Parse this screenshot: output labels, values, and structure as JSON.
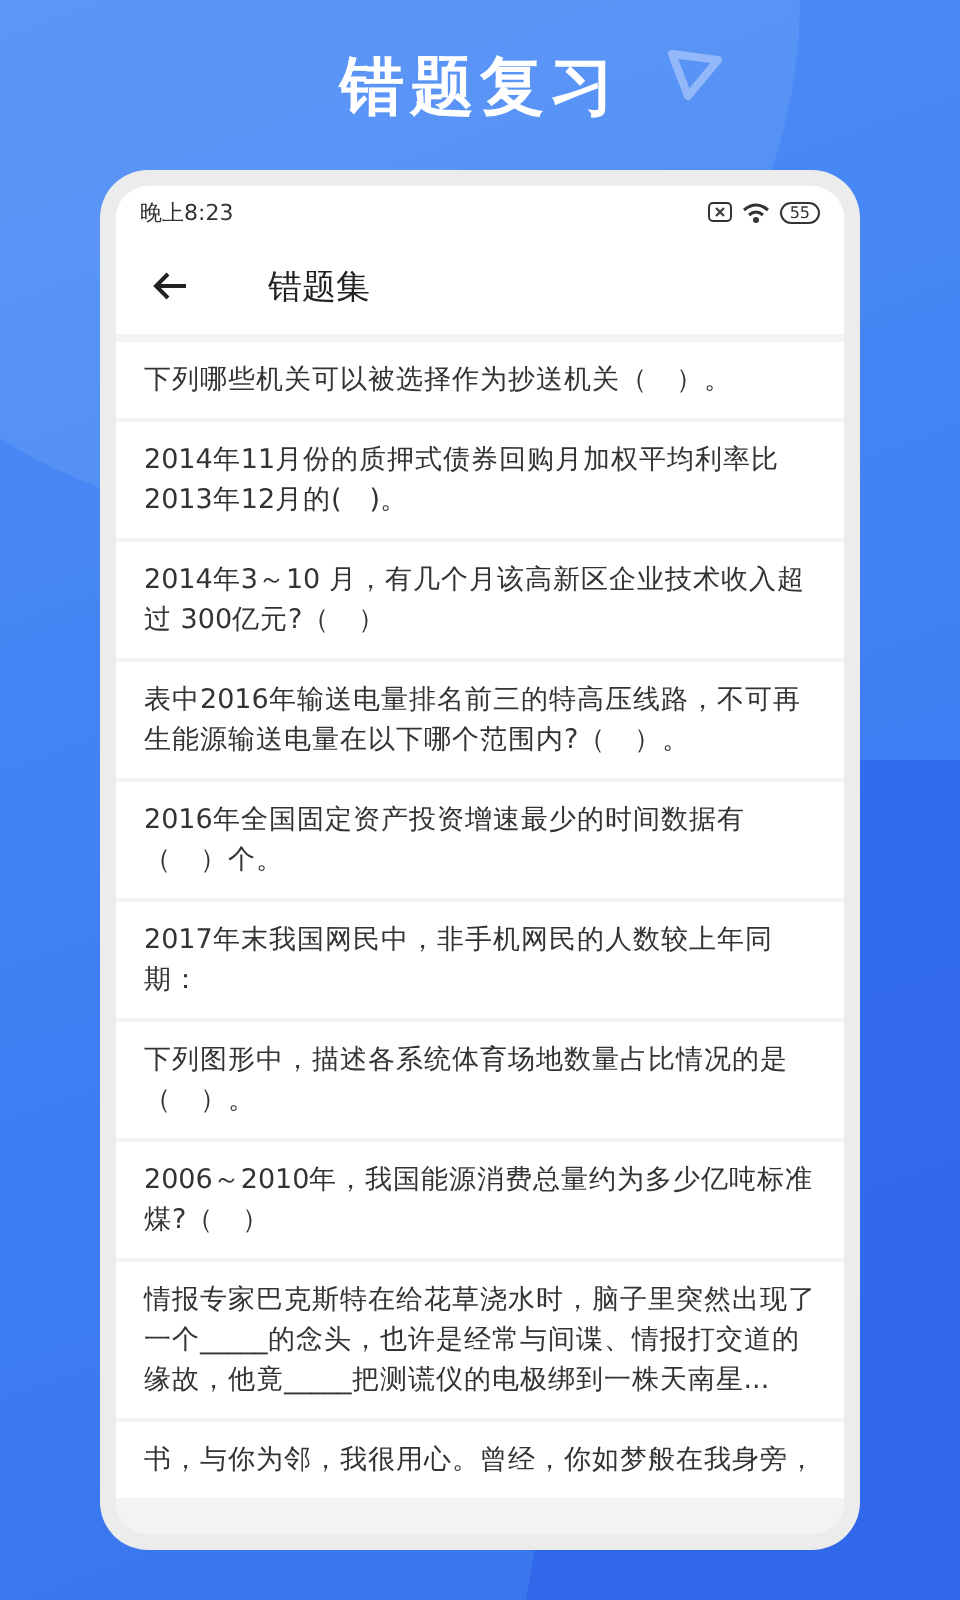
{
  "banner": {
    "title": "错题复习"
  },
  "status_bar": {
    "time": "晚上8:23",
    "battery": "55"
  },
  "toolbar": {
    "title": "错题集"
  },
  "questions": [
    {
      "text": "下列哪些机关可以被选择作为抄送机关（　）。"
    },
    {
      "text": "2014年11月份的质押式债券回购月加权平均利率比2013年12月的(　)。"
    },
    {
      "text": "2014年3～10 月，有几个月该高新区企业技术收入超过 300亿元?（　）"
    },
    {
      "text": "表中2016年输送电量排名前三的特高压线路，不可再生能源输送电量在以下哪个范围内?（　）。"
    },
    {
      "text": "2016年全国固定资产投资增速最少的时间数据有（　）个。"
    },
    {
      "text": "2017年末我国网民中，非手机网民的人数较上年同期："
    },
    {
      "text": "下列图形中，描述各系统体育场地数量占比情况的是（　）。"
    },
    {
      "text": "2006～2010年，我国能源消费总量约为多少亿吨标准煤?（　）"
    },
    {
      "text": "情报专家巴克斯特在给花草浇水时，脑子里突然出现了一个_____的念头，也许是经常与间谍、情报打交道的缘故，他竟_____把测谎仪的电极绑到一株天南星..."
    },
    {
      "text": "书，与你为邻，我很用心。曾经，你如梦般在我身旁，"
    }
  ]
}
